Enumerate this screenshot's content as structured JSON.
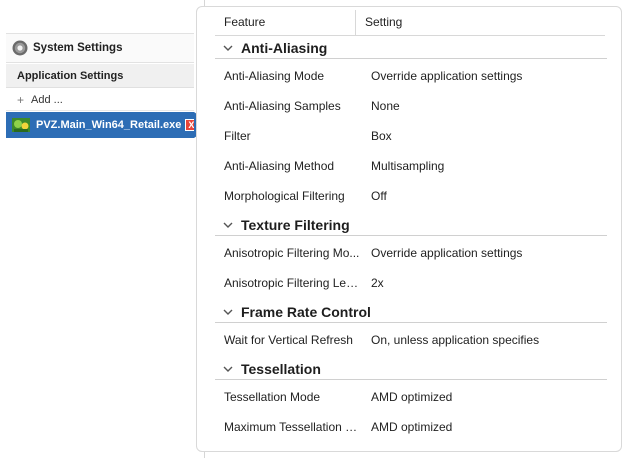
{
  "nav": {
    "system_settings": "System Settings",
    "application_settings": "Application Settings",
    "add": "Add ...",
    "selected_app": "PVZ.Main_Win64_Retail.exe",
    "remove_glyph": "X"
  },
  "table": {
    "col_feature": "Feature",
    "col_setting": "Setting"
  },
  "sections": [
    {
      "title": "Anti-Aliasing",
      "rows": [
        {
          "feature": "Anti-Aliasing Mode",
          "setting": "Override application settings"
        },
        {
          "feature": "Anti-Aliasing Samples",
          "setting": "None"
        },
        {
          "feature": "Filter",
          "setting": "Box"
        },
        {
          "feature": "Anti-Aliasing Method",
          "setting": "Multisampling"
        },
        {
          "feature": "Morphological Filtering",
          "setting": "Off"
        }
      ]
    },
    {
      "title": "Texture Filtering",
      "rows": [
        {
          "feature": "Anisotropic Filtering Mo...",
          "setting": "Override application settings"
        },
        {
          "feature": "Anisotropic Filtering Level",
          "setting": "2x"
        }
      ]
    },
    {
      "title": "Frame Rate Control",
      "rows": [
        {
          "feature": "Wait for Vertical Refresh",
          "setting": "On, unless application specifies"
        }
      ]
    },
    {
      "title": "Tessellation",
      "rows": [
        {
          "feature": "Tessellation Mode",
          "setting": "AMD optimized"
        },
        {
          "feature": "Maximum Tessellation L...",
          "setting": "AMD optimized"
        }
      ]
    }
  ],
  "colors": {
    "selected_bg": "#2d6db5",
    "remove_red": "#e8443a"
  },
  "icons": {
    "system": "gear-icon",
    "add": "plus-icon",
    "app": "app-thumbnail-icon",
    "remove": "close-icon",
    "section_toggle": "chevron-down-icon"
  }
}
